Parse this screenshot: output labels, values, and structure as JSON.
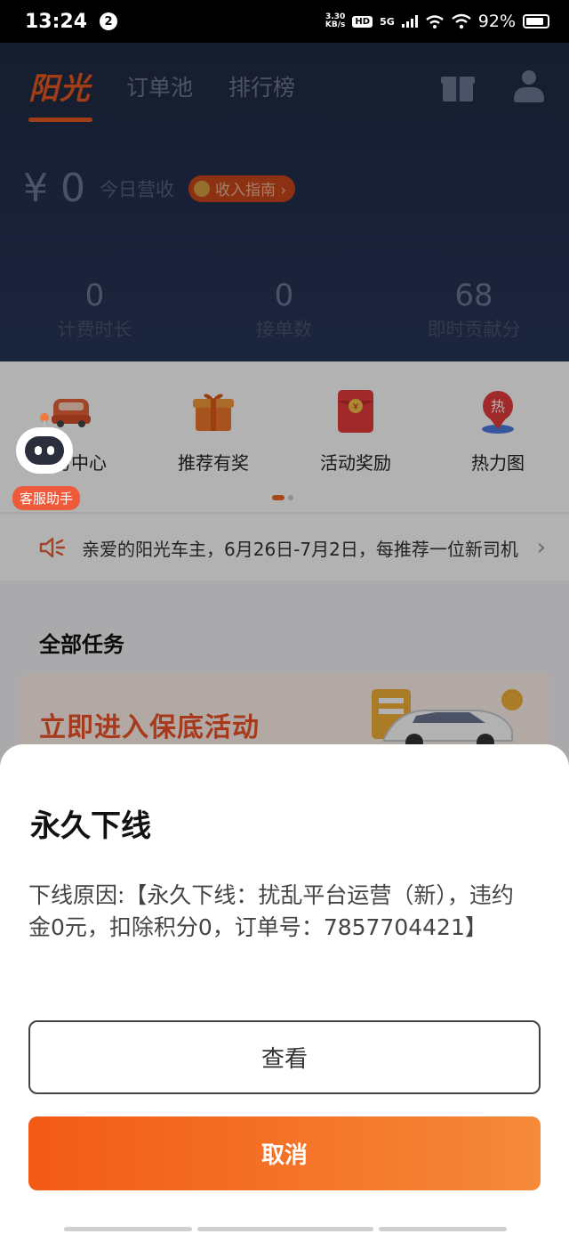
{
  "status_bar": {
    "time": "13:24",
    "notification_count": "2",
    "net_speed_value": "3.30",
    "net_speed_unit": "KB/s",
    "hd": "HD",
    "network": "5G",
    "battery": "92%"
  },
  "nav": {
    "logo": "阳光",
    "tabs": [
      "订单池",
      "排行榜"
    ],
    "icons": [
      "gift-icon",
      "user-icon"
    ]
  },
  "income": {
    "amount": "¥ 0",
    "label": "今日营收",
    "guide_label": "收入指南 ›"
  },
  "stats": [
    {
      "value": "0",
      "label": "计费时长"
    },
    {
      "value": "0",
      "label": "接单数"
    },
    {
      "value": "68",
      "label": "即时贡献分"
    }
  ],
  "services": [
    {
      "label": "服务中心",
      "icon": "car-icon"
    },
    {
      "label": "推荐有奖",
      "icon": "gift-box-icon"
    },
    {
      "label": "活动奖励",
      "icon": "red-envelope-icon"
    },
    {
      "label": "热力图",
      "icon": "heatmap-pin-icon"
    }
  ],
  "assistant": {
    "label": "客服助手"
  },
  "notice": {
    "text": "亲爱的阳光车主，6月26日-7月2日，每推荐一位新司机"
  },
  "tasks": {
    "title": "全部任务",
    "banner": "立即进入保底活动"
  },
  "sheet": {
    "title": "永久下线",
    "reason": "下线原因:【永久下线：扰乱平台运营（新），违约金0元，扣除积分0，订单号：7857704421】",
    "view_label": "查看",
    "cancel_label": "取消"
  },
  "colors": {
    "accent": "#f25a14",
    "header_bg": "#1f2a42"
  }
}
